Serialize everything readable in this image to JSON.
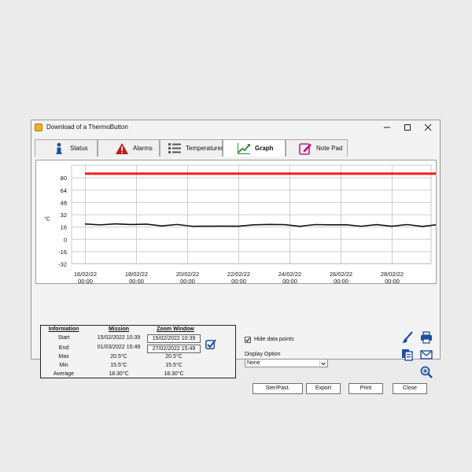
{
  "window": {
    "title": "Download of a ThermoButton"
  },
  "tabs": [
    {
      "label": "Status",
      "icon": "info-icon"
    },
    {
      "label": "Alarms",
      "icon": "warning-icon"
    },
    {
      "label": "Temperatures",
      "icon": "list-icon"
    },
    {
      "label": "Graph",
      "icon": "chart-icon",
      "active": true
    },
    {
      "label": "Note Pad",
      "icon": "notepad-icon"
    }
  ],
  "chart_data": {
    "type": "line",
    "ylabel": "°C",
    "ylim": [
      -32,
      96
    ],
    "yticks": [
      "80",
      "64",
      "48",
      "32",
      "16",
      "0",
      "-16",
      "-32"
    ],
    "xticks": [
      {
        "date": "16/02/22",
        "time": "00:00"
      },
      {
        "date": "18/02/22",
        "time": "00:00"
      },
      {
        "date": "20/02/22",
        "time": "00:00"
      },
      {
        "date": "22/02/22",
        "time": "00:00"
      },
      {
        "date": "24/02/22",
        "time": "00:00"
      },
      {
        "date": "26/02/22",
        "time": "00:00"
      },
      {
        "date": "28/02/22",
        "time": "00:00"
      }
    ],
    "grid": true,
    "series": [
      {
        "color": "#ff1a1a",
        "x_days_from_start": [
          0,
          14.7
        ],
        "values": [
          85,
          85
        ]
      },
      {
        "color": "#111111",
        "x_days_from_start": [
          0,
          0.6,
          1.2,
          1.8,
          2.4,
          3.0,
          3.6,
          4.2,
          4.8,
          5.4,
          6.0,
          6.6,
          7.2,
          7.8,
          8.4,
          9.0,
          9.6,
          10.2,
          10.8,
          11.4,
          12.0,
          12.6,
          13.2,
          13.8,
          14.4,
          14.7
        ],
        "values": [
          19.5,
          18.3,
          19.6,
          18.8,
          19.3,
          17.0,
          18.8,
          16.5,
          16.6,
          16.7,
          16.6,
          18.4,
          18.9,
          18.6,
          16.4,
          18.7,
          18.4,
          18.5,
          16.5,
          18.6,
          16.6,
          18.7,
          16.3,
          18.7,
          17.1,
          19.6
        ]
      }
    ]
  },
  "info": {
    "headers": [
      "Information",
      "Mission",
      "Zoom Window"
    ],
    "rows": [
      {
        "label": "Start",
        "mission": "15/02/2022 10:39",
        "zoom": "15/02/2022 10:39"
      },
      {
        "label": "End",
        "mission": "01/03/2022 15:49",
        "zoom": "27/02/2022 15:49"
      },
      {
        "label": "Max",
        "mission": "20.5°C",
        "zoom": "20.5°C"
      },
      {
        "label": "Min",
        "mission": "15.5°C",
        "zoom": "15.5°C"
      },
      {
        "label": "Average",
        "mission": "18.30°C",
        "zoom": "18.30°C"
      }
    ]
  },
  "options": {
    "hide_points_label": "Hide data points",
    "hide_points_checked": true,
    "display_option_label": "Display Option",
    "display_option_value": "None"
  },
  "buttons": {
    "copy": "Ster/Past.",
    "export": "Export",
    "print": "Print",
    "close": "Close"
  },
  "colors": {
    "accent_blue": "#1e4fa3",
    "alarm_red": "#ff1a1a"
  }
}
